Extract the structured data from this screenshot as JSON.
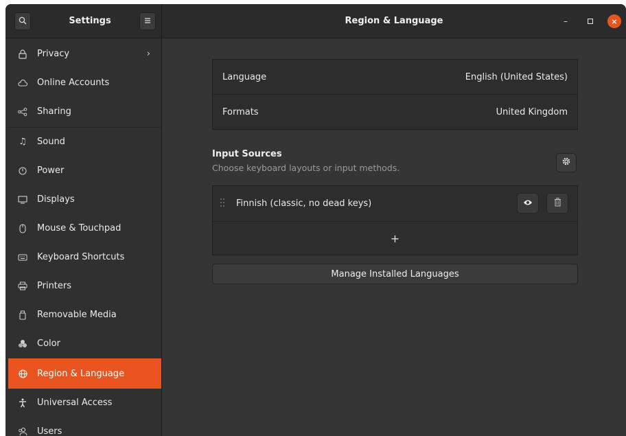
{
  "header": {
    "app_title": "Settings",
    "page_title": "Region & Language",
    "search_icon": "search-icon",
    "menu_icon": "hamburger-menu-icon",
    "minimize_glyph": "–",
    "maximize_glyph": "□",
    "close_glyph": "×"
  },
  "sidebar": {
    "items": [
      {
        "label": "Privacy",
        "icon": "lock-icon",
        "glyph": "🔒︎",
        "has_chevron": true
      },
      {
        "label": "Online Accounts",
        "icon": "cloud-icon",
        "glyph": "☁"
      },
      {
        "label": "Sharing",
        "icon": "share-icon",
        "glyph": "⋞"
      },
      {
        "label": "Sound",
        "icon": "music-note-icon",
        "glyph": "♫"
      },
      {
        "label": "Power",
        "icon": "power-icon",
        "glyph": "⏻"
      },
      {
        "label": "Displays",
        "icon": "display-icon",
        "glyph": "▭"
      },
      {
        "label": "Mouse & Touchpad",
        "icon": "mouse-icon",
        "glyph": "◯"
      },
      {
        "label": "Keyboard Shortcuts",
        "icon": "keyboard-icon",
        "glyph": "⌨"
      },
      {
        "label": "Printers",
        "icon": "printer-icon",
        "glyph": "⎙"
      },
      {
        "label": "Removable Media",
        "icon": "removable-media-icon",
        "glyph": "▯"
      },
      {
        "label": "Color",
        "icon": "color-icon",
        "glyph": "❖"
      },
      {
        "label": "Region & Language",
        "icon": "globe-icon",
        "glyph": "⊕",
        "active": true
      },
      {
        "label": "Universal Access",
        "icon": "accessibility-icon",
        "glyph": "✝"
      },
      {
        "label": "Users",
        "icon": "users-icon",
        "glyph": "⚇"
      }
    ],
    "chevron_glyph": "›"
  },
  "main": {
    "language": {
      "label": "Language",
      "value": "English (United States)"
    },
    "formats": {
      "label": "Formats",
      "value": "United Kingdom"
    },
    "input_sources": {
      "title": "Input Sources",
      "subtitle": "Choose keyboard layouts or input methods.",
      "options_icon": "gear-icon",
      "sources": [
        {
          "label": "Finnish (classic, no dead keys)",
          "preview_icon": "eye-icon",
          "remove_icon": "trash-icon"
        }
      ],
      "add_glyph": "+"
    },
    "manage_button": "Manage Installed Languages"
  },
  "colors": {
    "accent": "#e95420",
    "window_bg": "#353535",
    "sidebar_bg": "#303030",
    "header_bg": "#2b2b2b"
  }
}
